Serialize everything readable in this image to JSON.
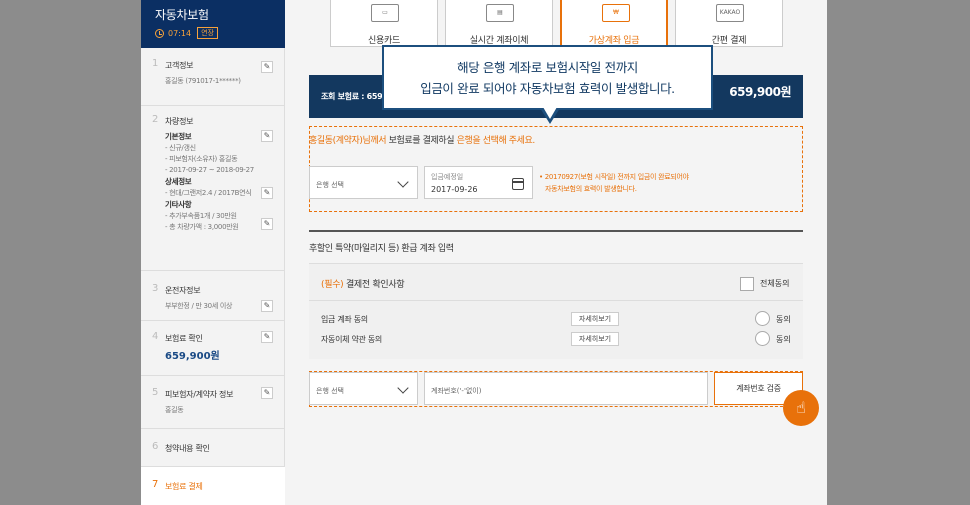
{
  "sidebar": {
    "product": "자동차보험",
    "timer": "07:14",
    "extend": "연장",
    "steps": [
      {
        "num": "1",
        "title": "고객정보",
        "lines": [
          "홍길동 (791017-1******)"
        ]
      },
      {
        "num": "2",
        "title": "차량정보",
        "groups": [
          {
            "head": "기본정보",
            "lines": [
              "- 신규/갱신",
              "- 피보험자(소유자) 홍길동",
              "- 2017-09-27 ~ 2018-09-27"
            ]
          },
          {
            "head": "상세정보",
            "lines": [
              "- 현대/그랜저2.4 / 2017B연식"
            ]
          },
          {
            "head": "기타사항",
            "lines": [
              "- 추가부속품1개 / 30만원",
              "- 총 차량가액 : 3,000만원"
            ]
          }
        ]
      },
      {
        "num": "3",
        "title": "운전자정보",
        "lines": [
          "부부한정 / 만 30세 이상"
        ]
      },
      {
        "num": "4",
        "title": "보험료 확인",
        "amount": "659,900원"
      },
      {
        "num": "5",
        "title": "피보험자/계약자 정보",
        "lines": [
          "홍길동"
        ]
      },
      {
        "num": "6",
        "title": "청약내용 확인"
      },
      {
        "num": "7",
        "title": "보험료 결제"
      }
    ]
  },
  "tabs": [
    {
      "label": "신용카드",
      "icon": "credit-card-icon"
    },
    {
      "label": "실시간 계좌이체",
      "icon": "atm-icon"
    },
    {
      "label": "가상계좌 입금",
      "icon": "money-bag-icon"
    },
    {
      "label": "간편 결제",
      "icon": "kakao-icon",
      "icon_text": "KAKAO"
    }
  ],
  "summary": {
    "label": "조회 보험료 : 659",
    "amount": "659,900원"
  },
  "notice": {
    "name": "홍길동(계약자)님께서",
    "mid": " 보험료를 결제하실 ",
    "tail": "은행을 선택해 주세요."
  },
  "bank_select": {
    "placeholder": "은행 선택"
  },
  "date": {
    "caption": "입금예정일",
    "value": "2017-09-26"
  },
  "hint": [
    "• 20170927(보험 시작일) 전까지 입금이 완료되어야",
    "자동차보험의 효력이 발생합니다."
  ],
  "refund": {
    "title": "후할인 특약(마일리지 등) 환급 계좌 입력"
  },
  "consent": {
    "required": "(필수)",
    "title": " 결제전 확인사항",
    "all_agree": "전체동의",
    "items": [
      {
        "label": "입금 계좌 동의",
        "detail": "자세히보기",
        "agree": "동의"
      },
      {
        "label": "자동이체 약관 동의",
        "detail": "자세히보기",
        "agree": "동의"
      }
    ]
  },
  "refund_bank_select": {
    "placeholder": "은행 선택"
  },
  "account_input": {
    "placeholder": "계좌번호('-'없이)"
  },
  "verify_button": "계좌번호 검증",
  "tooltip": [
    "해당 은행 계좌로 보험시작일 전까지",
    "입금이 완료 되어야 자동차보험 효력이 발생합니다."
  ],
  "colors": {
    "accent": "#e8710a",
    "navy": "#0b2f63"
  }
}
